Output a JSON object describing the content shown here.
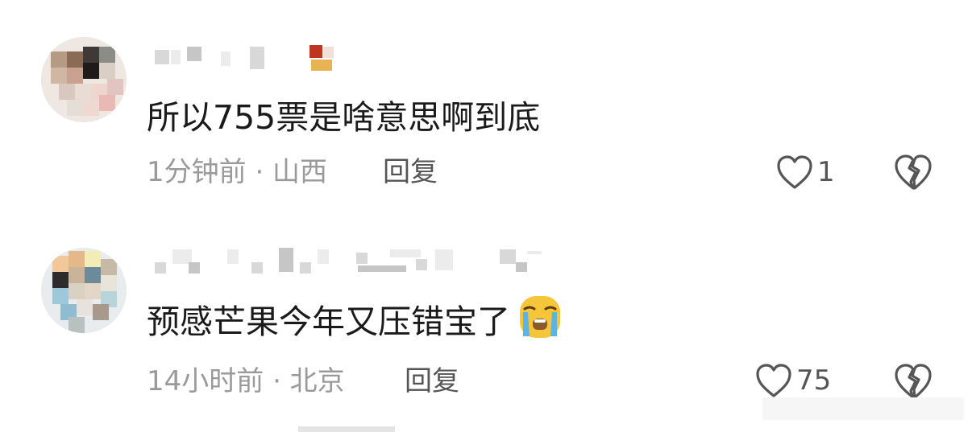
{
  "comments": [
    {
      "text": "所以755票是啥意思啊到底",
      "meta": "1分钟前 · 山西",
      "reply_label": "回复",
      "likes": "1"
    },
    {
      "text": "预感芒果今年又压错宝了",
      "meta": "14小时前 · 北京",
      "reply_label": "回复",
      "likes": "75",
      "emoji": "crying-face-emoji"
    }
  ],
  "icons": {
    "like": "heart-outline-icon",
    "dislike": "broken-heart-icon"
  },
  "colors": {
    "text": "#1a1a1a",
    "meta": "#9a9a9a",
    "action": "#555555",
    "emoji_yellow": "#f6c63a",
    "emoji_tear": "#5fb2e4"
  }
}
